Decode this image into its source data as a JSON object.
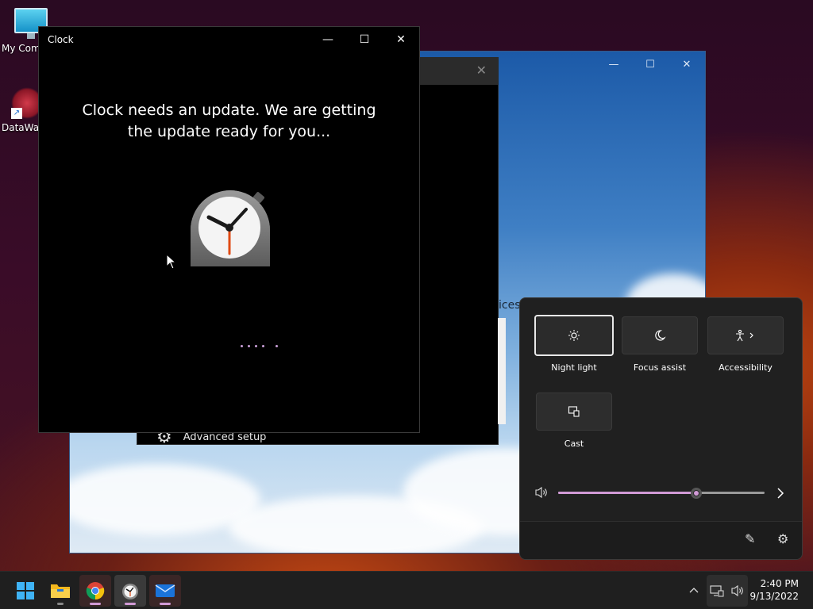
{
  "desktop": {
    "icons": [
      {
        "label": "My Com"
      },
      {
        "label": "DataWag"
      }
    ]
  },
  "setup_window": {
    "peek_text": "ices",
    "advanced_label": "Advanced setup"
  },
  "clock_window": {
    "title": "Clock",
    "message_line1": "Clock needs an update. We are getting",
    "message_line2": "the update ready for you..."
  },
  "quick_settings": {
    "tiles": [
      {
        "label": "Night light",
        "icon": "night-light-icon",
        "selected": true
      },
      {
        "label": "Focus assist",
        "icon": "moon-icon",
        "selected": false
      },
      {
        "label": "Accessibility",
        "icon": "accessibility-icon",
        "selected": false
      },
      {
        "label": "Cast",
        "icon": "cast-icon",
        "selected": false
      }
    ],
    "volume_fraction": 0.67,
    "accent": "#d19ad6"
  },
  "taskbar": {
    "apps": [
      "Start",
      "File Explorer",
      "Google Chrome",
      "Clock",
      "Mail"
    ],
    "time": "2:40 PM",
    "date": "9/13/2022"
  }
}
